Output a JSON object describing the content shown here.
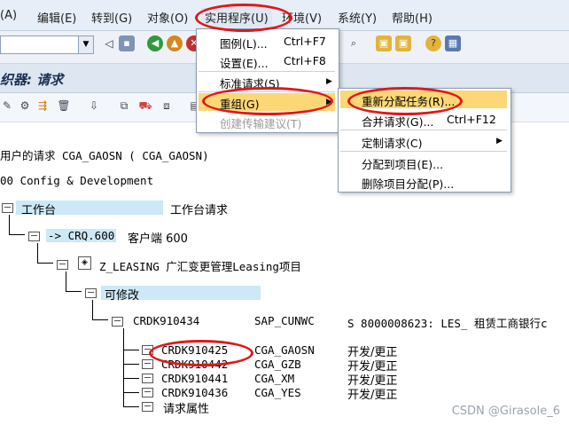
{
  "menubar": {
    "items": [
      {
        "label": "(A)"
      },
      {
        "label": "编辑(E)"
      },
      {
        "label": "转到(G)"
      },
      {
        "label": "对象(O)"
      },
      {
        "label": "实用程序(U)"
      },
      {
        "label": "环境(V)"
      },
      {
        "label": "系统(Y)"
      },
      {
        "label": "帮助(H)"
      }
    ]
  },
  "title": "织器: 请求",
  "utilities_menu": {
    "items": [
      {
        "label": "图例(L)...",
        "shortcut": "Ctrl+F7"
      },
      {
        "label": "设置(E)...",
        "shortcut": "Ctrl+F8"
      },
      {
        "label": "标准请求(S)"
      },
      {
        "label": "重组(G)"
      },
      {
        "label": "创建传输建议(T)"
      }
    ]
  },
  "reorg_submenu": {
    "items": [
      {
        "label": "重新分配任务(R)..."
      },
      {
        "label": "合并请求(G)...",
        "shortcut": "Ctrl+F12"
      },
      {
        "label": "定制请求(C)"
      },
      {
        "label": "分配到项目(E)..."
      },
      {
        "label": "删除项目分配(P)..."
      }
    ]
  },
  "tree": {
    "header": "用户的请求 CGA_GAOSN ( CGA_GAOSN)",
    "root": "00 Config & Development",
    "workbench": {
      "label": "工作台",
      "desc": "工作台请求"
    },
    "client": {
      "label": "-> CRQ.600",
      "desc": "客户端 600"
    },
    "project": "Z_LEASING 广汇变更管理Leasing项目",
    "modifiable": "可修改",
    "request": {
      "id": "CRDK910434",
      "owner": "SAP_CUNWC",
      "desc": "S 8000008623: LES_ 租赁工商银行c"
    },
    "tasks": [
      {
        "id": "CRDK910425",
        "owner": "CGA_GAOSN",
        "type": "开发/更正"
      },
      {
        "id": "CRDK910442",
        "owner": "CGA_GZB",
        "type": "开发/更正"
      },
      {
        "id": "CRDK910441",
        "owner": "CGA_XM",
        "type": "开发/更正"
      },
      {
        "id": "CRDK910436",
        "owner": "CGA_YES",
        "type": "开发/更正"
      }
    ],
    "attributes": "请求属性"
  },
  "watermark": "CSDN @Girasole_6",
  "colors": {
    "highlight": "#fcd776",
    "annotation": "#e01818",
    "tree_highlight": "#cde8f6"
  }
}
